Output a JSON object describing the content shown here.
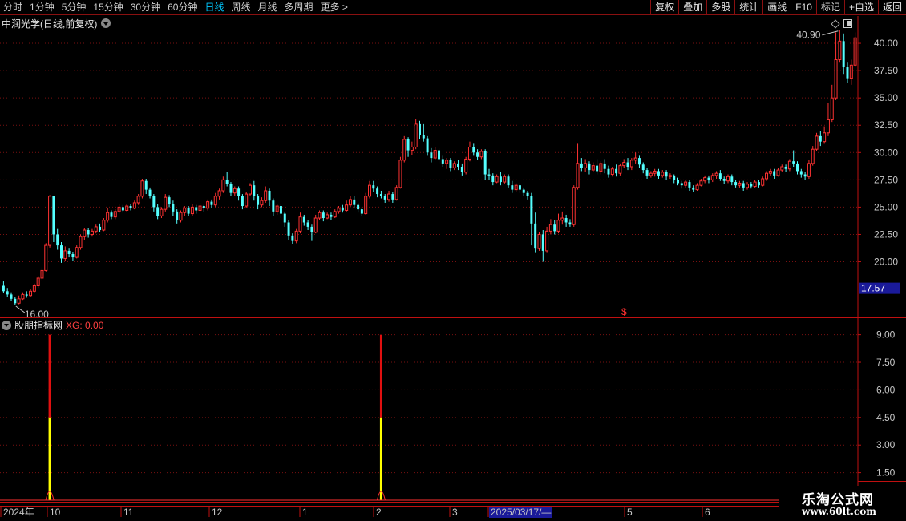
{
  "toolbar": {
    "periods": [
      {
        "label": "分时",
        "active": false
      },
      {
        "label": "1分钟",
        "active": false
      },
      {
        "label": "5分钟",
        "active": false
      },
      {
        "label": "15分钟",
        "active": false
      },
      {
        "label": "30分钟",
        "active": false
      },
      {
        "label": "60分钟",
        "active": false
      },
      {
        "label": "日线",
        "active": true
      },
      {
        "label": "周线",
        "active": false
      },
      {
        "label": "月线",
        "active": false
      },
      {
        "label": "多周期",
        "active": false
      },
      {
        "label": "更多 >",
        "active": false
      }
    ],
    "right_buttons": [
      "复权",
      "叠加",
      "多股",
      "统计",
      "画线",
      "F10",
      "标记",
      "+自选",
      "返回"
    ]
  },
  "main_chart": {
    "title": "中润光学(日线,前复权)",
    "price_axis": [
      "40.00",
      "37.50",
      "35.00",
      "32.50",
      "30.00",
      "27.50",
      "25.00",
      "22.50",
      "20.00"
    ],
    "current_price": "17.57",
    "high_label": "40.90",
    "low_label": "16.00",
    "dollar_mark": "$"
  },
  "indicator": {
    "name": "股朋指标网",
    "xg_label": "XG: 0.00",
    "axis": [
      "9.00",
      "7.50",
      "6.00",
      "4.50",
      "3.00",
      "1.50"
    ]
  },
  "date_axis": [
    "2024年",
    "10",
    "11",
    "12",
    "1",
    "2",
    "3",
    "2025/03/17/—",
    "5",
    "6"
  ],
  "watermark": {
    "title": "乐淘公式网",
    "url": "www.60lt.com"
  },
  "chart_data": {
    "type": "candlestick",
    "y_range": [
      14.9,
      42.5
    ],
    "indicator_range": [
      0,
      9.9
    ],
    "candles": [
      [
        17.8,
        17.3,
        18.2,
        17.1
      ],
      [
        17.3,
        17.0,
        17.6,
        16.8
      ],
      [
        17.0,
        16.6,
        17.2,
        16.4
      ],
      [
        16.6,
        16.2,
        16.8,
        16.0
      ],
      [
        16.2,
        16.6,
        16.9,
        16.1
      ],
      [
        16.6,
        17.0,
        17.2,
        16.5
      ],
      [
        17.0,
        16.9,
        17.3,
        16.7
      ],
      [
        16.9,
        17.3,
        17.5,
        16.8
      ],
      [
        17.3,
        17.8,
        18.0,
        17.2
      ],
      [
        17.8,
        18.5,
        18.7,
        17.6
      ],
      [
        18.5,
        19.2,
        19.5,
        18.3
      ],
      [
        19.2,
        21.5,
        21.7,
        19.1
      ],
      [
        21.5,
        26.0,
        26.1,
        21.3
      ],
      [
        26.0,
        22.5,
        24.1,
        21.8
      ],
      [
        22.5,
        21.5,
        23.0,
        21.1
      ],
      [
        21.5,
        20.3,
        21.8,
        19.9
      ],
      [
        20.3,
        21.0,
        21.4,
        20.1
      ],
      [
        21.0,
        20.7,
        21.2,
        20.4
      ],
      [
        20.7,
        20.4,
        20.9,
        20.1
      ],
      [
        20.4,
        21.3,
        21.5,
        20.3
      ],
      [
        21.3,
        22.3,
        22.5,
        21.1
      ],
      [
        22.3,
        22.9,
        23.1,
        22.0
      ],
      [
        22.9,
        22.5,
        23.1,
        22.2
      ],
      [
        22.5,
        22.8,
        23.0,
        22.3
      ],
      [
        22.8,
        23.2,
        23.4,
        22.6
      ],
      [
        23.2,
        22.9,
        23.5,
        22.7
      ],
      [
        22.9,
        23.8,
        24.0,
        22.8
      ],
      [
        23.8,
        24.5,
        24.9,
        23.6
      ],
      [
        24.5,
        24.1,
        24.7,
        23.9
      ],
      [
        24.1,
        24.6,
        24.8,
        23.9
      ],
      [
        24.6,
        25.0,
        25.3,
        24.4
      ],
      [
        25.0,
        24.7,
        25.2,
        24.5
      ],
      [
        24.7,
        25.1,
        25.3,
        24.6
      ],
      [
        25.1,
        24.9,
        25.3,
        24.7
      ],
      [
        24.9,
        25.4,
        25.6,
        24.8
      ],
      [
        25.4,
        26.0,
        26.2,
        25.2
      ],
      [
        26.0,
        27.4,
        27.6,
        25.8
      ],
      [
        27.4,
        26.6,
        27.6,
        26.2
      ],
      [
        26.6,
        26.0,
        26.8,
        25.8
      ],
      [
        26.0,
        25.0,
        26.2,
        24.6
      ],
      [
        25.0,
        24.2,
        25.3,
        23.9
      ],
      [
        24.2,
        24.8,
        25.0,
        24.0
      ],
      [
        24.8,
        25.9,
        26.2,
        24.6
      ],
      [
        25.9,
        25.3,
        26.1,
        25.0
      ],
      [
        25.3,
        24.6,
        25.6,
        24.2
      ],
      [
        24.6,
        23.8,
        24.8,
        23.5
      ],
      [
        23.8,
        24.5,
        24.7,
        23.6
      ],
      [
        24.5,
        24.9,
        25.1,
        24.2
      ],
      [
        24.9,
        24.4,
        25.1,
        24.2
      ],
      [
        24.4,
        25.0,
        25.3,
        24.2
      ],
      [
        25.0,
        24.7,
        25.2,
        24.4
      ],
      [
        24.7,
        25.1,
        25.4,
        24.6
      ],
      [
        25.1,
        24.9,
        25.2,
        24.6
      ],
      [
        24.9,
        25.5,
        25.7,
        24.7
      ],
      [
        25.5,
        25.2,
        25.7,
        24.9
      ],
      [
        25.2,
        26.0,
        26.3,
        25.0
      ],
      [
        26.0,
        26.5,
        26.7,
        25.7
      ],
      [
        26.5,
        27.5,
        27.8,
        26.3
      ],
      [
        27.5,
        27.1,
        28.2,
        26.9
      ],
      [
        27.1,
        26.3,
        27.3,
        26.0
      ],
      [
        26.3,
        26.7,
        26.9,
        26.0
      ],
      [
        26.7,
        26.0,
        26.9,
        25.6
      ],
      [
        26.0,
        25.1,
        26.2,
        24.8
      ],
      [
        25.1,
        26.2,
        26.4,
        24.9
      ],
      [
        26.2,
        27.0,
        27.2,
        26.0
      ],
      [
        27.0,
        26.0,
        27.4,
        25.6
      ],
      [
        26.0,
        25.2,
        26.2,
        24.8
      ],
      [
        25.2,
        25.6,
        25.9,
        25.0
      ],
      [
        25.6,
        26.5,
        26.9,
        25.4
      ],
      [
        26.5,
        25.6,
        26.7,
        25.1
      ],
      [
        25.6,
        24.6,
        25.8,
        24.2
      ],
      [
        24.6,
        25.1,
        25.3,
        24.3
      ],
      [
        25.1,
        24.4,
        25.3,
        24.0
      ],
      [
        24.4,
        23.6,
        24.6,
        23.2
      ],
      [
        23.6,
        22.4,
        23.8,
        22.0
      ],
      [
        22.4,
        21.9,
        22.6,
        21.6
      ],
      [
        21.9,
        22.8,
        23.0,
        21.7
      ],
      [
        22.8,
        24.1,
        24.5,
        22.6
      ],
      [
        24.1,
        23.6,
        24.3,
        23.3
      ],
      [
        23.6,
        23.2,
        23.8,
        22.9
      ],
      [
        23.2,
        22.7,
        23.4,
        21.9
      ],
      [
        22.7,
        24.0,
        24.3,
        22.6
      ],
      [
        24.0,
        24.5,
        24.7,
        23.8
      ],
      [
        24.5,
        24.0,
        24.7,
        23.7
      ],
      [
        24.0,
        24.3,
        24.5,
        23.9
      ],
      [
        24.3,
        24.1,
        24.5,
        23.8
      ],
      [
        24.1,
        24.6,
        24.8,
        24.0
      ],
      [
        24.6,
        24.9,
        25.1,
        24.4
      ],
      [
        24.9,
        24.7,
        25.2,
        24.5
      ],
      [
        24.7,
        25.2,
        25.6,
        24.6
      ],
      [
        25.2,
        25.7,
        26.0,
        25.0
      ],
      [
        25.7,
        25.2,
        26.0,
        24.9
      ],
      [
        25.2,
        24.8,
        25.4,
        24.5
      ],
      [
        24.8,
        24.4,
        25.0,
        24.2
      ],
      [
        24.4,
        26.0,
        26.3,
        24.3
      ],
      [
        26.0,
        27.0,
        27.4,
        25.8
      ],
      [
        27.0,
        26.7,
        27.4,
        26.4
      ],
      [
        26.7,
        26.2,
        26.9,
        25.9
      ],
      [
        26.2,
        26.0,
        26.5,
        25.8
      ],
      [
        26.0,
        25.7,
        26.2,
        25.4
      ],
      [
        25.7,
        26.2,
        26.5,
        25.5
      ],
      [
        26.2,
        25.7,
        26.4,
        25.4
      ],
      [
        25.7,
        26.8,
        27.0,
        25.6
      ],
      [
        26.8,
        29.3,
        29.6,
        26.7
      ],
      [
        29.3,
        31.2,
        31.5,
        29.1
      ],
      [
        31.2,
        30.2,
        31.4,
        29.6
      ],
      [
        30.2,
        30.5,
        31.0,
        29.8
      ],
      [
        30.5,
        32.6,
        33.1,
        30.3
      ],
      [
        32.6,
        31.6,
        32.9,
        31.2
      ],
      [
        31.6,
        31.3,
        32.6,
        31.0
      ],
      [
        31.3,
        30.0,
        31.5,
        29.7
      ],
      [
        30.0,
        29.5,
        30.4,
        29.1
      ],
      [
        29.5,
        30.2,
        30.5,
        29.3
      ],
      [
        30.2,
        29.4,
        30.4,
        29.0
      ],
      [
        29.4,
        29.0,
        29.7,
        28.7
      ],
      [
        29.0,
        29.3,
        29.5,
        28.5
      ],
      [
        29.3,
        28.6,
        29.5,
        28.3
      ],
      [
        28.6,
        29.0,
        29.2,
        28.4
      ],
      [
        29.0,
        28.7,
        29.3,
        28.4
      ],
      [
        28.7,
        28.2,
        29.0,
        27.9
      ],
      [
        28.2,
        29.4,
        29.6,
        28.0
      ],
      [
        29.4,
        30.5,
        31.0,
        29.2
      ],
      [
        30.5,
        30.0,
        30.8,
        29.7
      ],
      [
        30.0,
        29.6,
        30.3,
        29.3
      ],
      [
        29.6,
        30.1,
        30.3,
        29.4
      ],
      [
        30.1,
        28.0,
        30.3,
        27.5
      ],
      [
        28.0,
        27.9,
        28.5,
        27.5
      ],
      [
        27.9,
        27.3,
        28.1,
        27.0
      ],
      [
        27.3,
        27.8,
        28.0,
        27.2
      ],
      [
        27.8,
        27.3,
        28.2,
        27.0
      ],
      [
        27.3,
        27.8,
        28.0,
        27.1
      ],
      [
        27.8,
        27.0,
        28.0,
        26.8
      ],
      [
        27.0,
        26.6,
        27.4,
        26.3
      ],
      [
        26.6,
        27.0,
        27.2,
        26.4
      ],
      [
        27.0,
        26.6,
        27.2,
        26.3
      ],
      [
        26.6,
        26.3,
        26.8,
        26.0
      ],
      [
        26.3,
        26.0,
        26.5,
        25.7
      ],
      [
        26.0,
        23.5,
        26.3,
        21.5
      ],
      [
        23.5,
        21.2,
        24.5,
        20.8
      ],
      [
        21.2,
        22.5,
        22.7,
        21.0
      ],
      [
        22.5,
        21.0,
        22.9,
        20.0
      ],
      [
        21.0,
        22.8,
        23.2,
        20.8
      ],
      [
        22.8,
        23.4,
        23.9,
        22.5
      ],
      [
        23.4,
        22.8,
        23.8,
        22.5
      ],
      [
        22.8,
        23.8,
        24.4,
        22.6
      ],
      [
        23.8,
        24.0,
        24.6,
        23.4
      ],
      [
        24.0,
        23.6,
        24.3,
        23.2
      ],
      [
        23.6,
        23.4,
        23.9,
        23.2
      ],
      [
        23.4,
        26.8,
        27.0,
        23.2
      ],
      [
        26.8,
        29.0,
        30.8,
        26.6
      ],
      [
        29.0,
        28.6,
        29.5,
        28.3
      ],
      [
        28.6,
        29.0,
        29.4,
        28.2
      ],
      [
        29.0,
        28.4,
        29.2,
        28.0
      ],
      [
        28.4,
        28.8,
        29.1,
        28.2
      ],
      [
        28.8,
        28.3,
        29.4,
        28.0
      ],
      [
        28.3,
        29.0,
        29.2,
        28.0
      ],
      [
        29.0,
        28.5,
        29.4,
        28.1
      ],
      [
        28.5,
        28.0,
        28.8,
        27.7
      ],
      [
        28.0,
        28.5,
        28.7,
        27.8
      ],
      [
        28.5,
        28.1,
        28.9,
        27.8
      ],
      [
        28.1,
        28.8,
        29.0,
        27.9
      ],
      [
        28.8,
        29.1,
        29.4,
        28.6
      ],
      [
        29.1,
        28.7,
        29.5,
        28.4
      ],
      [
        28.7,
        29.3,
        29.5,
        28.4
      ],
      [
        29.3,
        29.5,
        30.0,
        29.0
      ],
      [
        29.5,
        28.9,
        29.7,
        28.6
      ],
      [
        28.9,
        28.4,
        29.1,
        28.1
      ],
      [
        28.4,
        27.9,
        28.6,
        27.6
      ],
      [
        27.9,
        28.1,
        28.3,
        27.7
      ],
      [
        28.1,
        28.3,
        28.5,
        27.8
      ],
      [
        28.3,
        27.9,
        28.5,
        27.6
      ],
      [
        27.9,
        28.2,
        28.4,
        27.7
      ],
      [
        28.2,
        27.8,
        28.4,
        27.5
      ],
      [
        27.8,
        27.9,
        28.1,
        27.6
      ],
      [
        27.9,
        27.5,
        28.0,
        27.2
      ],
      [
        27.5,
        27.2,
        27.7,
        27.0
      ],
      [
        27.2,
        27.0,
        27.4,
        26.7
      ],
      [
        27.0,
        27.3,
        27.5,
        26.8
      ],
      [
        27.3,
        26.8,
        27.5,
        26.5
      ],
      [
        26.8,
        26.6,
        27.0,
        26.4
      ],
      [
        26.6,
        27.0,
        27.2,
        26.5
      ],
      [
        27.0,
        27.4,
        27.6,
        26.9
      ],
      [
        27.4,
        27.7,
        27.9,
        27.2
      ],
      [
        27.7,
        27.5,
        27.9,
        27.2
      ],
      [
        27.5,
        27.9,
        28.1,
        27.3
      ],
      [
        27.9,
        28.1,
        28.3,
        27.6
      ],
      [
        28.1,
        27.6,
        28.4,
        27.4
      ],
      [
        27.6,
        27.4,
        27.8,
        27.1
      ],
      [
        27.4,
        27.8,
        28.0,
        27.2
      ],
      [
        27.8,
        27.3,
        28.0,
        27.0
      ],
      [
        27.3,
        27.0,
        27.5,
        26.8
      ],
      [
        27.0,
        27.2,
        27.4,
        26.8
      ],
      [
        27.2,
        26.8,
        27.4,
        26.5
      ],
      [
        26.8,
        27.1,
        27.3,
        26.6
      ],
      [
        27.1,
        26.9,
        27.3,
        26.7
      ],
      [
        26.9,
        27.3,
        27.5,
        26.8
      ],
      [
        27.3,
        27.0,
        27.5,
        26.8
      ],
      [
        27.0,
        27.6,
        27.8,
        26.9
      ],
      [
        27.6,
        28.1,
        28.3,
        27.4
      ],
      [
        28.1,
        28.3,
        28.5,
        27.9
      ],
      [
        28.3,
        27.9,
        28.5,
        27.6
      ],
      [
        27.9,
        28.4,
        28.6,
        27.8
      ],
      [
        28.4,
        28.7,
        28.9,
        28.2
      ],
      [
        28.7,
        28.5,
        28.9,
        28.2
      ],
      [
        28.5,
        29.2,
        29.4,
        28.3
      ],
      [
        29.2,
        29.0,
        30.2,
        28.7
      ],
      [
        29.0,
        28.3,
        29.2,
        28.0
      ],
      [
        28.3,
        28.0,
        28.5,
        27.7
      ],
      [
        28.0,
        27.8,
        28.2,
        27.5
      ],
      [
        27.8,
        29.0,
        29.3,
        27.6
      ],
      [
        29.0,
        30.3,
        30.6,
        28.8
      ],
      [
        30.3,
        31.5,
        31.8,
        30.1
      ],
      [
        31.5,
        31.0,
        32.0,
        30.6
      ],
      [
        31.0,
        31.8,
        32.4,
        30.8
      ],
      [
        31.8,
        33.0,
        34.5,
        31.5
      ],
      [
        33.0,
        35.0,
        36.2,
        32.8
      ],
      [
        35.0,
        38.5,
        41.0,
        34.8
      ],
      [
        38.5,
        40.2,
        41.2,
        38.3
      ],
      [
        40.2,
        37.8,
        40.9,
        37.2
      ],
      [
        37.8,
        36.8,
        38.3,
        36.4
      ],
      [
        36.8,
        38.0,
        38.5,
        36.2
      ],
      [
        38.0,
        40.5,
        41.0,
        37.8
      ]
    ],
    "indicator_spikes": [
      {
        "bar": 12,
        "value": 9
      },
      {
        "bar": 98,
        "value": 9
      }
    ]
  }
}
